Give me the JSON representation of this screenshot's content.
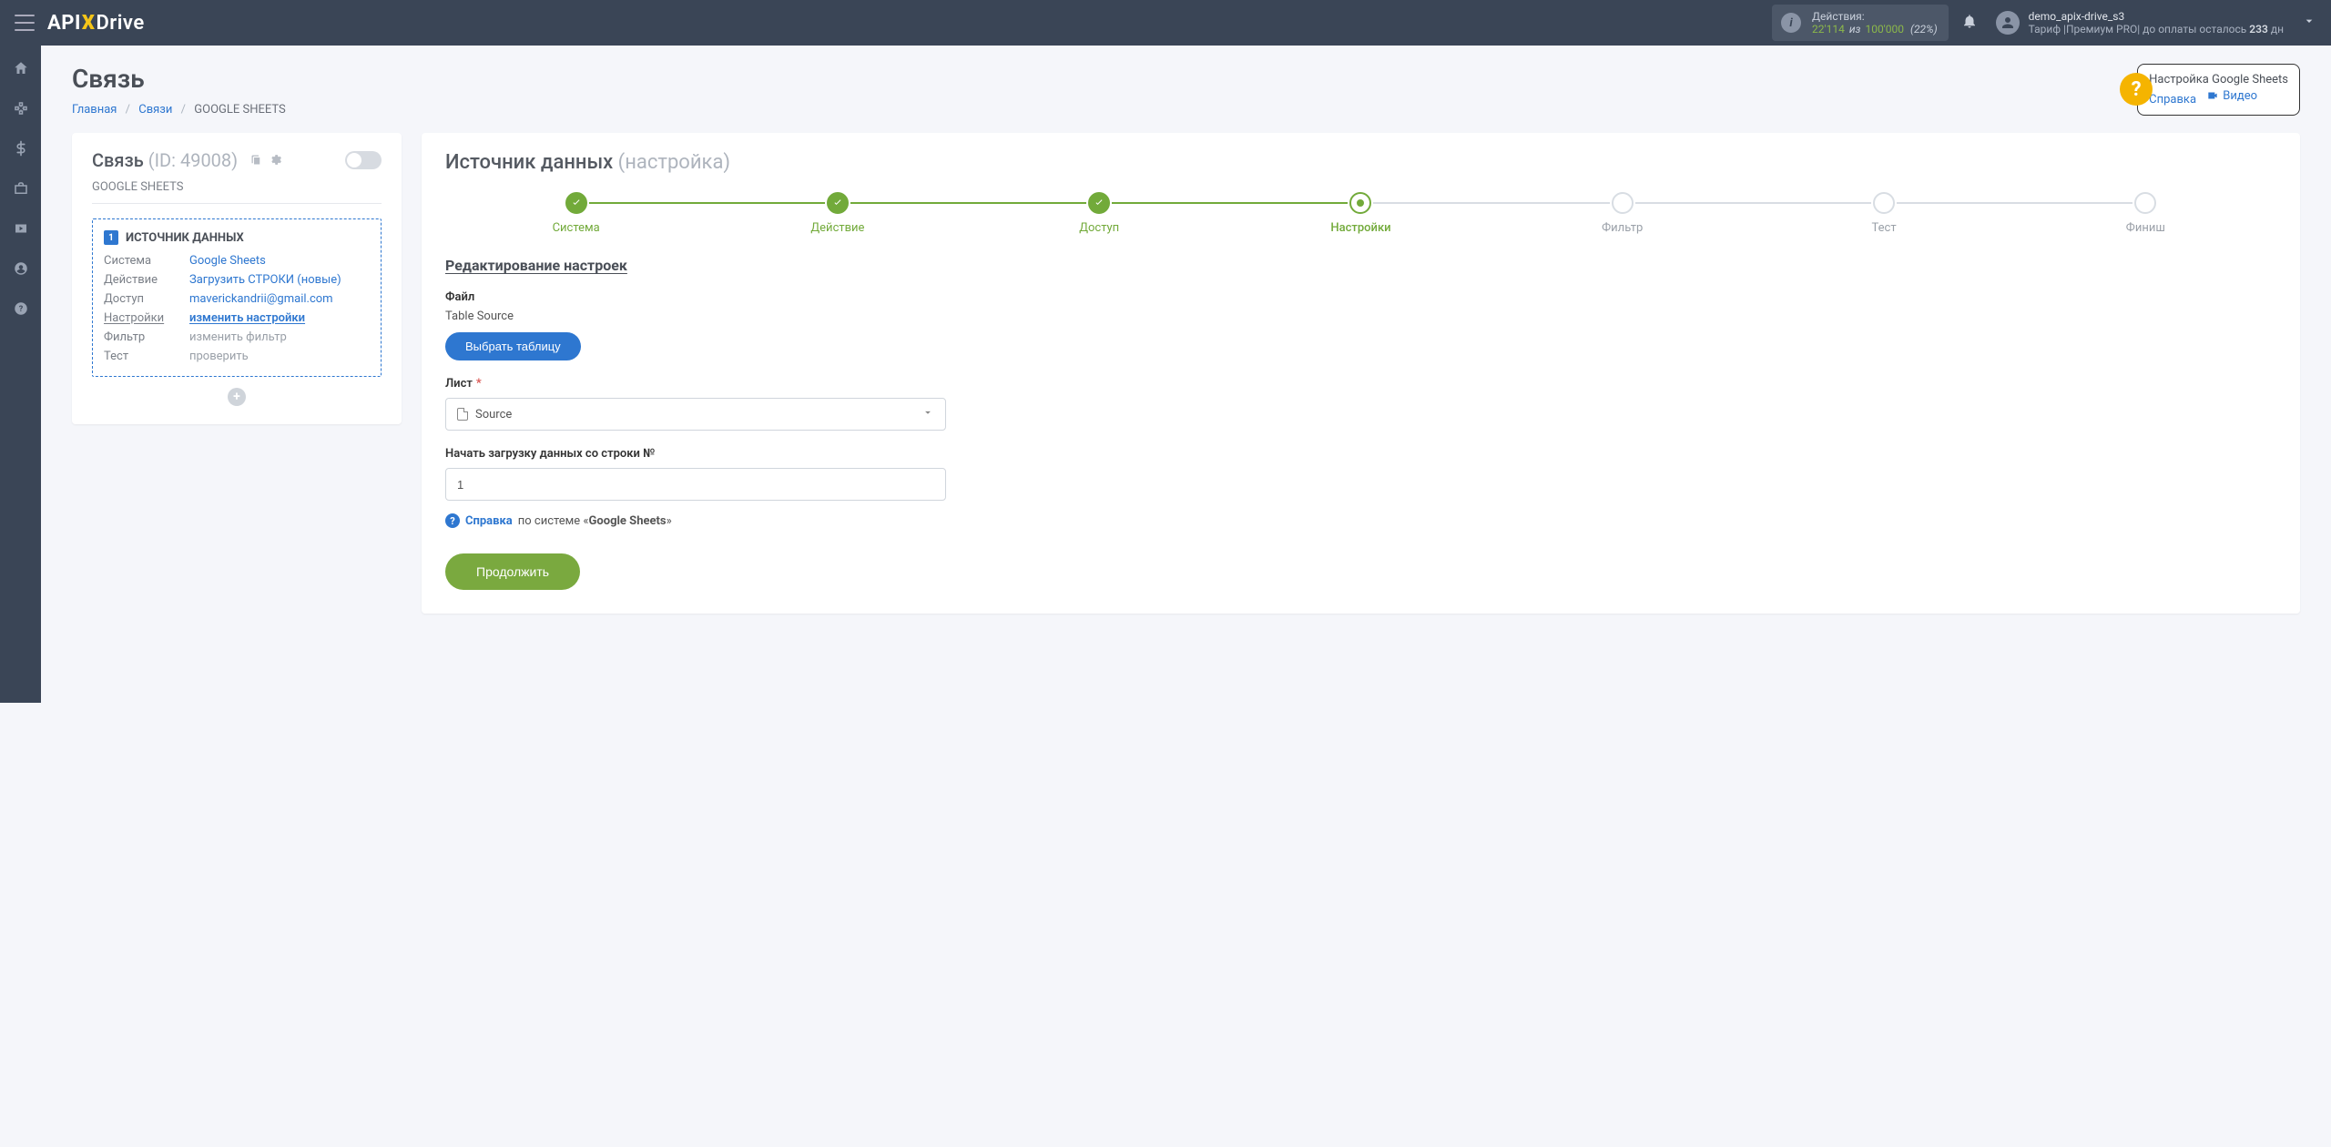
{
  "header": {
    "logo": {
      "api": "API",
      "x": "X",
      "drive": "Drive"
    },
    "actions": {
      "label": "Действия:",
      "count": "22'114",
      "of_word": "из",
      "total": "100'000",
      "pct": "(22%)"
    },
    "user": {
      "name": "demo_apix-drive_s3",
      "plan_prefix": "Тариф |Премиум PRO| до оплаты осталось ",
      "days": "233",
      "days_suffix": " дн"
    }
  },
  "page": {
    "title": "Связь",
    "breadcrumb": {
      "home": "Главная",
      "links": "Связи",
      "current": "GOOGLE SHEETS"
    }
  },
  "help": {
    "title": "Настройка Google Sheets",
    "ref": "Справка",
    "video": "Видео"
  },
  "side": {
    "title": "Связь",
    "id": "(ID: 49008)",
    "subtitle": "GOOGLE SHEETS",
    "source": {
      "badge": "1",
      "heading": "ИСТОЧНИК ДАННЫХ",
      "rows": {
        "system_l": "Система",
        "system_v": "Google Sheets",
        "action_l": "Действие",
        "action_v": "Загрузить СТРОКИ (новые)",
        "access_l": "Доступ",
        "access_v": "maverickandrii@gmail.com",
        "settings_l": "Настройки",
        "settings_v": "изменить настройки",
        "filter_l": "Фильтр",
        "filter_v": "изменить фильтр",
        "test_l": "Тест",
        "test_v": "проверить"
      }
    }
  },
  "main": {
    "title": "Источник данных",
    "title_light": "(настройка)",
    "steps": [
      "Система",
      "Действие",
      "Доступ",
      "Настройки",
      "Фильтр",
      "Тест",
      "Финиш"
    ],
    "section": "Редактирование настроек",
    "file_label": "Файл",
    "file_value": "Table Source",
    "file_button": "Выбрать таблицу",
    "sheet_label": "Лист",
    "sheet_value": "Source",
    "start_label": "Начать загрузку данных со строки №",
    "start_value": "1",
    "help": {
      "ref": "Справка",
      "mid": " по системе «",
      "sys": "Google Sheets",
      "end": "»"
    },
    "continue": "Продолжить"
  }
}
